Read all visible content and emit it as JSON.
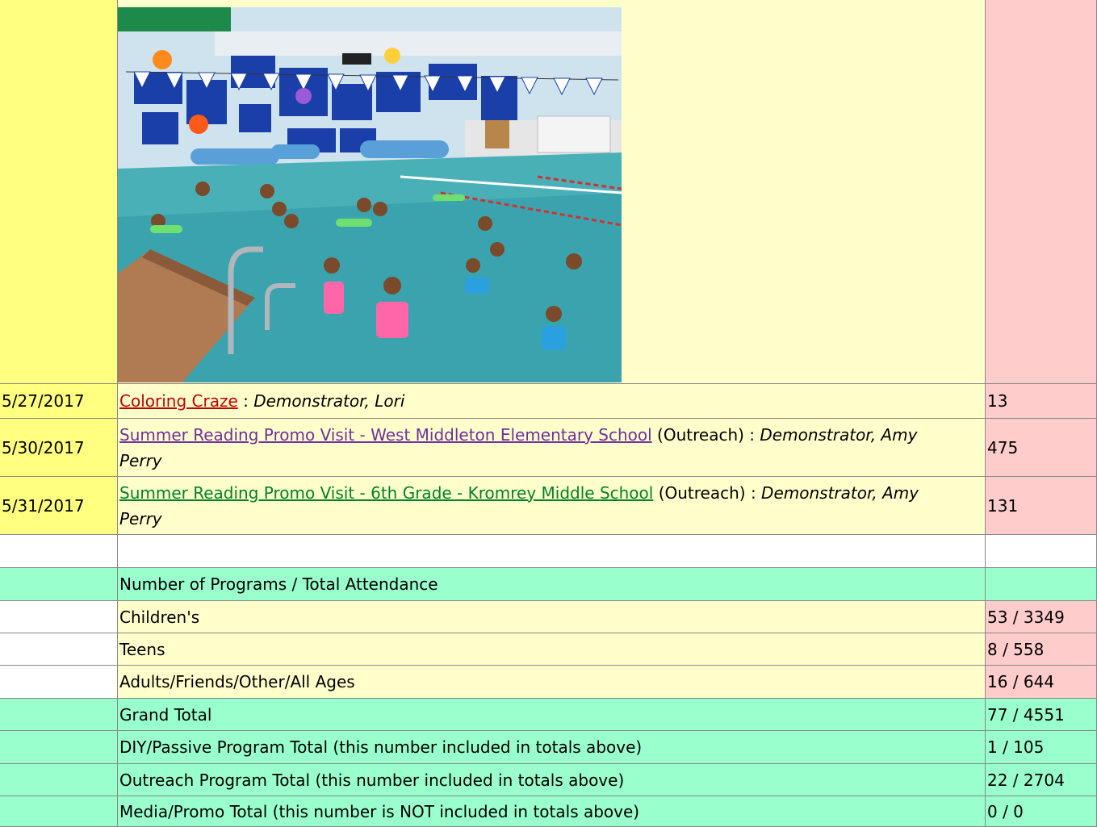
{
  "events": [
    {
      "date": "5/27/2017",
      "title": "Coloring Craze",
      "suffix": " : ",
      "role": "Demonstrator, Lori",
      "count": "13"
    },
    {
      "date": "5/30/2017",
      "title": "Summer Reading Promo Visit - West Middleton Elementary School",
      "suffix": " (Outreach) : ",
      "role": "Demonstrator, Amy Perry",
      "count": "475"
    },
    {
      "date": "5/31/2017",
      "title": "Summer Reading Promo Visit - 6th Grade - Kromrey Middle School",
      "suffix": " (Outreach) : ",
      "role": "Demonstrator, Amy Perry",
      "count": "131"
    }
  ],
  "summary": {
    "header": "Number of Programs / Total Attendance",
    "rows": [
      {
        "label": "Children's",
        "value": "53 / 3349"
      },
      {
        "label": "Teens",
        "value": "8 / 558"
      },
      {
        "label": "Adults/Friends/Other/All Ages",
        "value": "16 / 644"
      },
      {
        "label": "Grand Total",
        "value": "77 / 4551"
      },
      {
        "label": "DIY/Passive Program Total (this number included in totals above)",
        "value": "1 / 105"
      },
      {
        "label": "Outreach Program Total (this number included in totals above)",
        "value": "22 / 2704"
      },
      {
        "label": "Media/Promo Total (this number is NOT included in totals above)",
        "value": "0 / 0"
      }
    ]
  },
  "photo": {
    "name": "indoor swimming pool photo"
  }
}
